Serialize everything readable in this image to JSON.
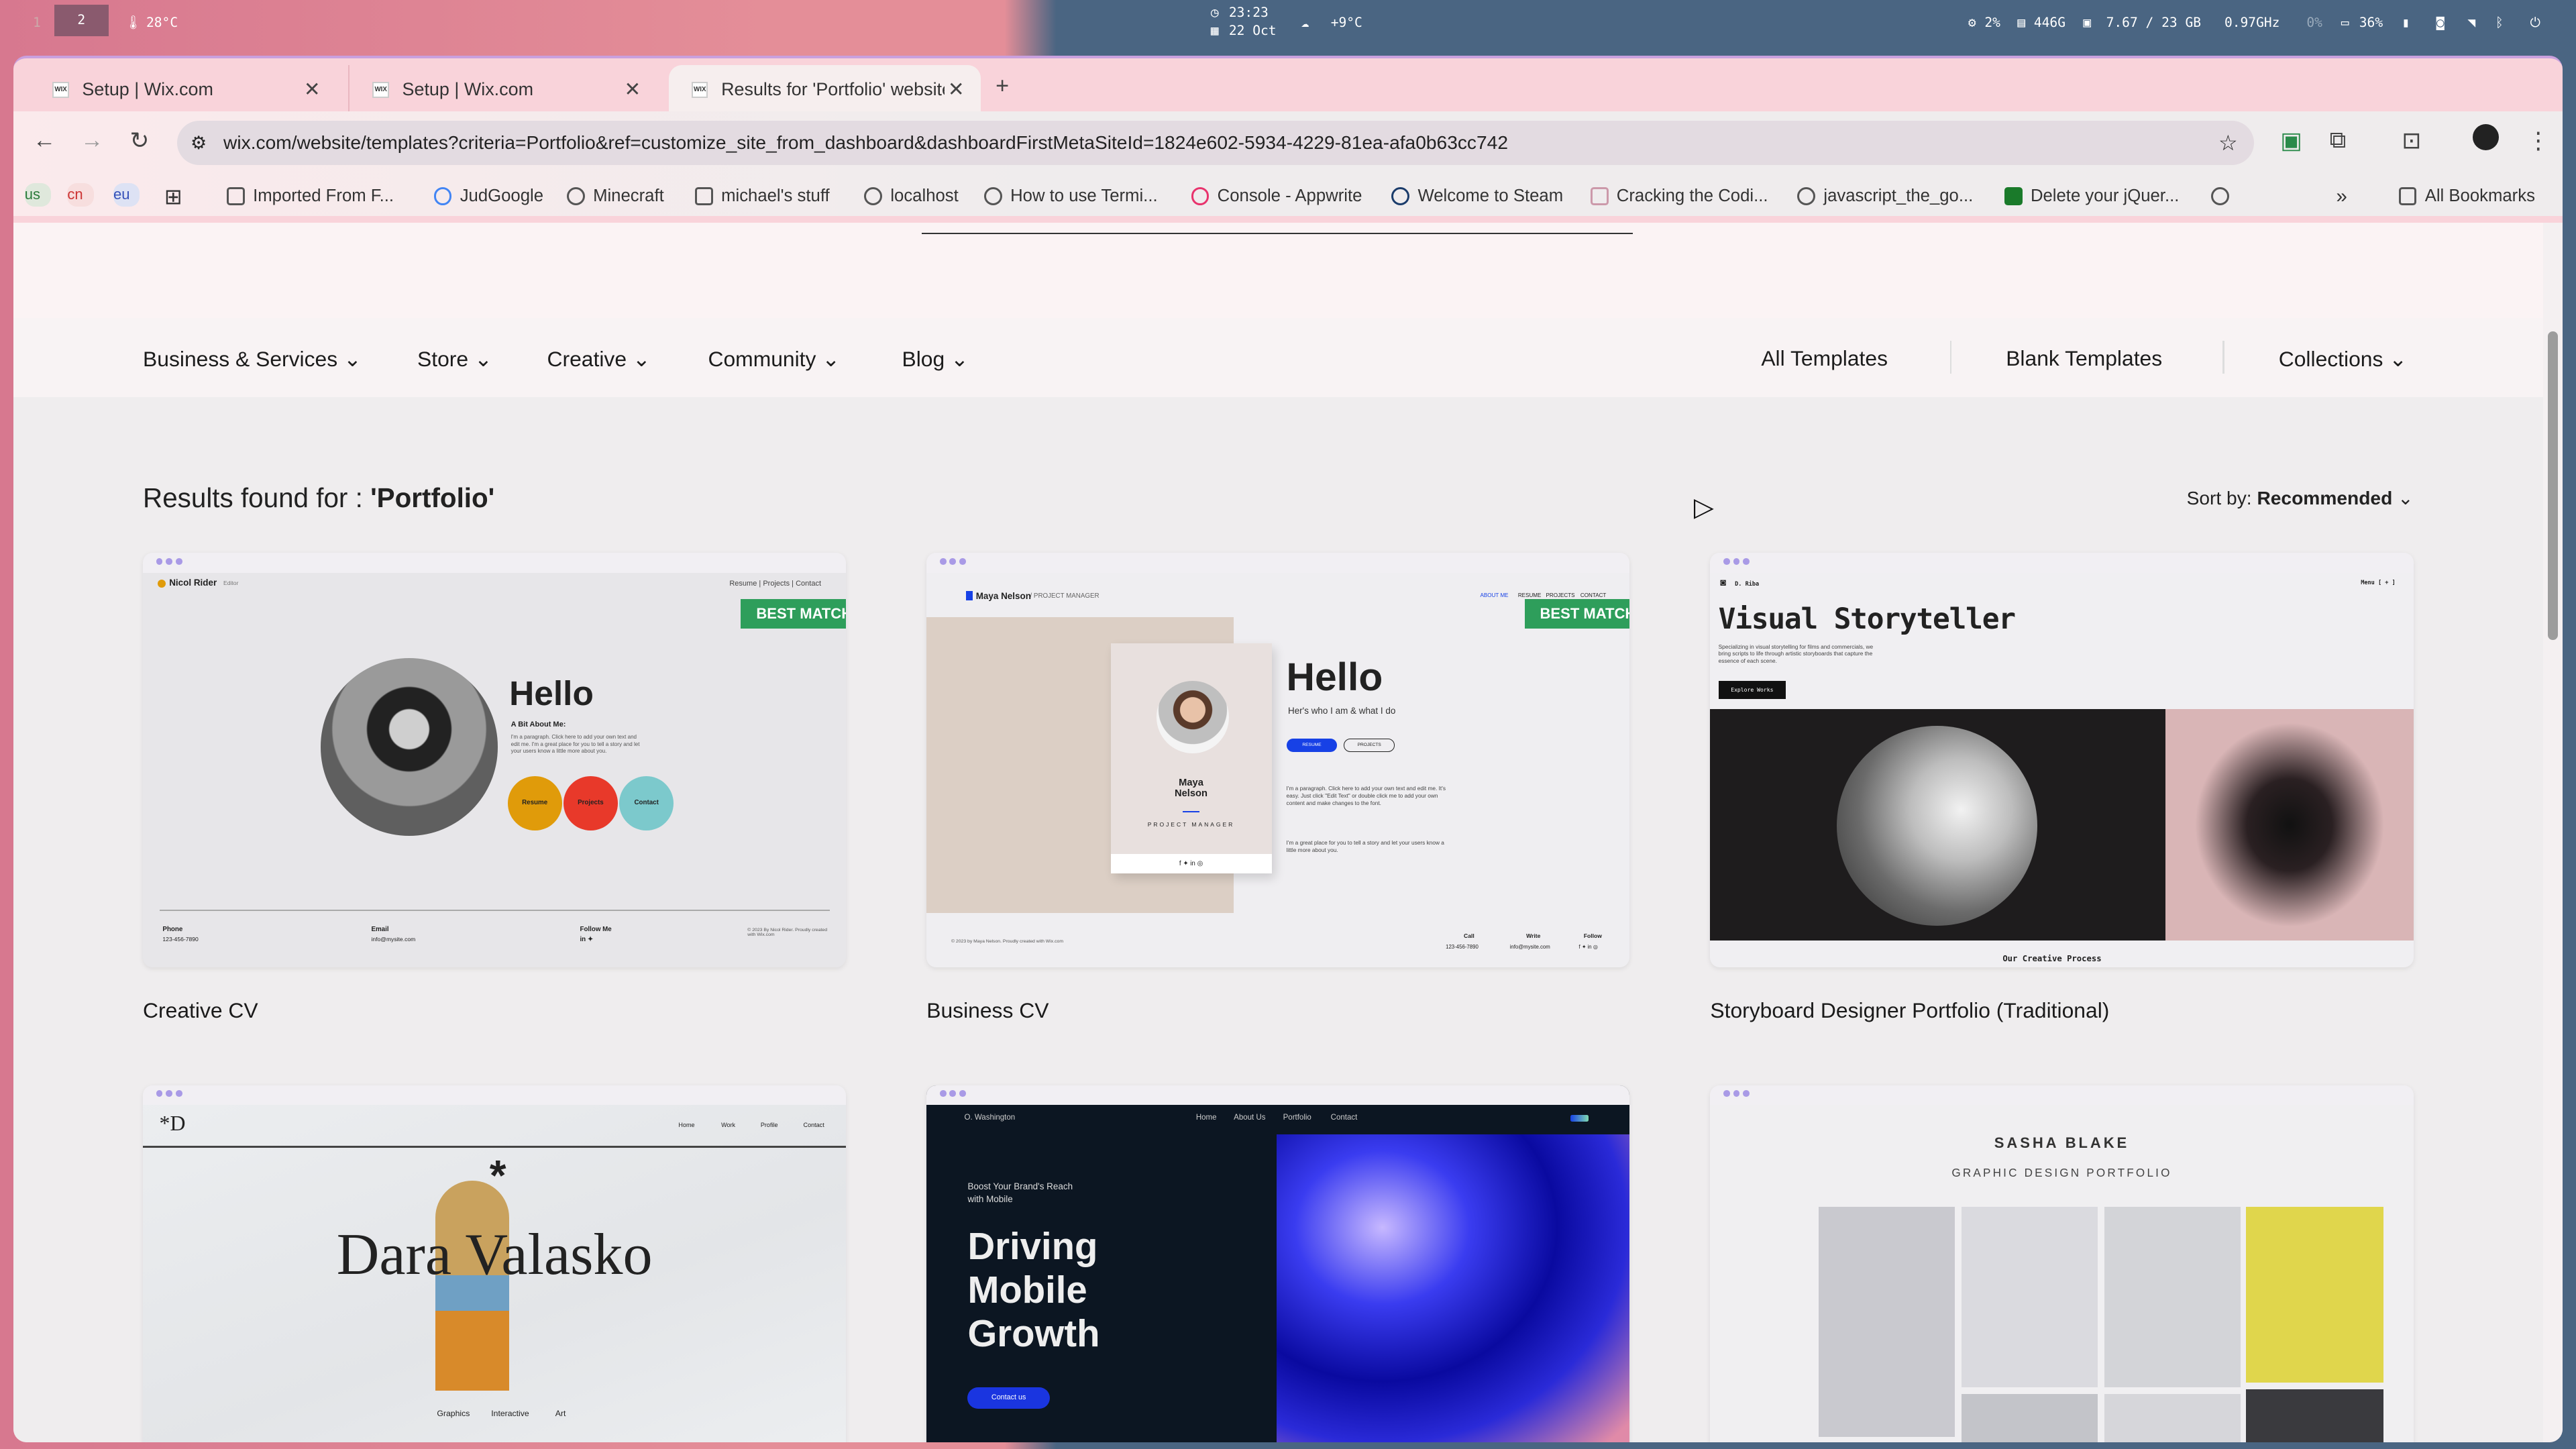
{
  "system_bar": {
    "workspaces": [
      "1",
      "2"
    ],
    "temperature": "28°C",
    "time": "23:23",
    "date": "22 Oct",
    "weather": "+9°C",
    "cpu": "2%",
    "disk": "446G",
    "memory": "7.67 / 23 GB",
    "freq": "0.97GHz",
    "gpu": "0%",
    "battery": "36%"
  },
  "tabs": [
    {
      "title": "Setup | Wix.com"
    },
    {
      "title": "Setup | Wix.com"
    },
    {
      "title": "Results for 'Portfolio' website"
    }
  ],
  "url": "wix.com/website/templates?criteria=Portfolio&ref=customize_site_from_dashboard&dashboardFirstMetaSiteId=1824e602-5934-4229-81ea-afa0b63cc742",
  "bookmarks": {
    "badges": [
      "us",
      "cn",
      "eu"
    ],
    "items": [
      "Imported From F...",
      "JudGoogle",
      "Minecraft",
      "michael's stuff",
      "localhost",
      "How to use Termi...",
      "Console - Appwrite",
      "Welcome to Steam",
      "Cracking the Codi...",
      "javascript_the_go...",
      "Delete your jQuer..."
    ],
    "all": "All Bookmarks"
  },
  "nav": {
    "left": [
      "Business & Services",
      "Store",
      "Creative",
      "Community",
      "Blog"
    ],
    "right": [
      "All Templates",
      "Blank Templates",
      "Collections"
    ]
  },
  "results": {
    "prefix": "Results found for : ",
    "query": "'Portfolio'",
    "sort_label": "Sort by: ",
    "sort_value": "Recommended"
  },
  "best_match": "BEST MATCH",
  "cards": [
    {
      "name": "Creative CV",
      "preview": {
        "logo": "Nicol Rider",
        "logo_sub": "Editor",
        "nav": "Resume | Projects | Contact",
        "hello": "Hello",
        "about": "A Bit About Me:",
        "para": "I'm a paragraph. Click here to add your own text and edit me. I'm a great place for you to tell a story and let your users know a little more about you.",
        "buttons": [
          "Resume",
          "Projects",
          "Contact"
        ],
        "footer": [
          "Phone",
          "123-456-7890",
          "Email",
          "info@mysite.com",
          "Follow Me",
          "© 2023 By Nicol Rider. Proudly created with Wix.com"
        ]
      }
    },
    {
      "name": "Business CV",
      "preview": {
        "logo": "Maya Nelson",
        "logo_sub": "/  PROJECT MANAGER",
        "nav": [
          "ABOUT ME",
          "RESUME",
          "PROJECTS",
          "CONTACT"
        ],
        "card_name": "Maya Nelson",
        "card_role": "PROJECT MANAGER",
        "hello": "Hello",
        "sub": "Her's who I am & what I do",
        "buttons": [
          "RESUME",
          "PROJECTS"
        ],
        "para1": "I'm a paragraph. Click here to add your own text and edit me. It's easy. Just click \"Edit Text\" or double click me to add your own content and make changes to the font.",
        "para2": "I'm a great place for you to tell a story and let your users know a little more about you.",
        "footer": [
          "© 2023 by Maya Nelson. Proudly created with Wix.com",
          "Call",
          "123-456-7890",
          "Write",
          "info@mysite.com",
          "Follow"
        ]
      }
    },
    {
      "name": "Storyboard Designer Portfolio (Traditional)",
      "preview": {
        "logo": "D. Riba",
        "menu": "Menu [ + ]",
        "headline": "Visual Storyteller",
        "para": "Specializing in visual storytelling for films and commercials, we bring scripts to life through artistic storyboards that capture the essence of each scene.",
        "button": "Explore Works",
        "section": "Our Creative Process"
      }
    },
    {
      "preview": {
        "logo": "*D",
        "nav": [
          "Home",
          "Work",
          "Profile",
          "Contact"
        ],
        "name": "Dara Valasko",
        "links": [
          "Graphics",
          "Interactive",
          "Art"
        ]
      }
    },
    {
      "preview": {
        "logo": "O. Washington",
        "nav": [
          "Home",
          "About Us",
          "Portfolio",
          "Contact"
        ],
        "kicker": "Boost Your Brand's Reach with Mobile",
        "headline": "Driving Mobile Growth",
        "button": "Contact us"
      }
    },
    {
      "preview": {
        "name": "SASHA BLAKE",
        "sub": "GRAPHIC DESIGN PORTFOLIO"
      }
    }
  ],
  "colors": {
    "best_match": "#2e9e5b",
    "accent_blue": "#1741e6"
  }
}
